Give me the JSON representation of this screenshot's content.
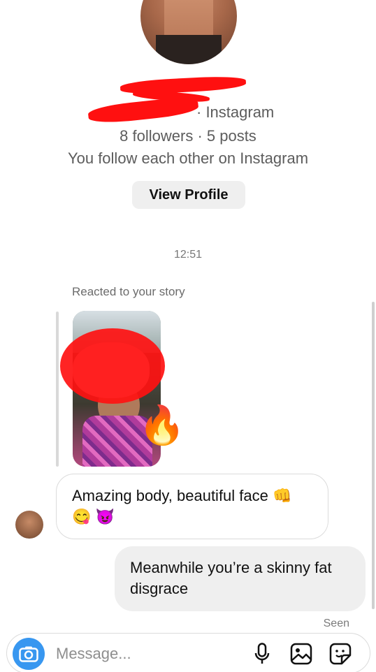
{
  "profile": {
    "platform_suffix": "· Instagram",
    "stats": "8 followers · 5 posts",
    "mutual": "You follow each other on Instagram",
    "view_profile_label": "View Profile"
  },
  "thread": {
    "timestamp": "12:51",
    "story_caption": "Reacted to your story",
    "story_reaction": "🔥",
    "messages": [
      {
        "from": "them",
        "text": "Amazing body, beautiful face 👊 😋 😈"
      },
      {
        "from": "me",
        "text": "Meanwhile you’re a skinny fat disgrace"
      }
    ],
    "seen_label": "Seen"
  },
  "composer": {
    "placeholder": "Message...",
    "icons": [
      "camera-icon",
      "microphone-icon",
      "gallery-icon",
      "sticker-icon"
    ]
  },
  "colors": {
    "accent_blue": "#3897f0",
    "redaction_red": "#ff1010",
    "bubble_out_bg": "#efefef"
  }
}
